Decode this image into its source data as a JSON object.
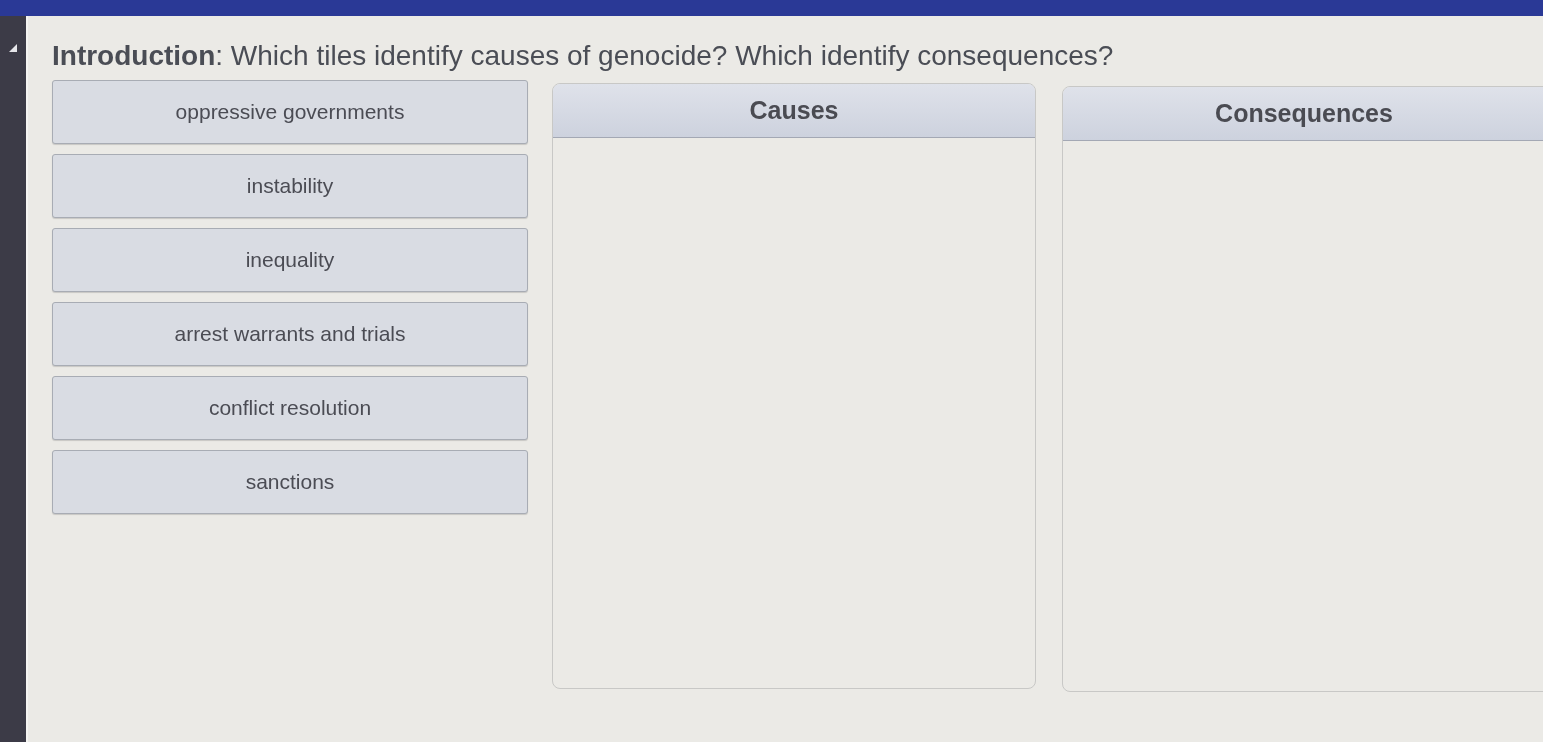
{
  "instruction": "**Introduction**: Which tiles identify causes of genocide? Which identify consequences?",
  "tiles": [
    {
      "label": "oppressive governments"
    },
    {
      "label": "instability"
    },
    {
      "label": "inequality"
    },
    {
      "label": "arrest warrants and trials"
    },
    {
      "label": "conflict resolution"
    },
    {
      "label": "sanctions"
    }
  ],
  "columns": [
    {
      "heading": "Causes"
    },
    {
      "heading": "Consequences"
    }
  ]
}
